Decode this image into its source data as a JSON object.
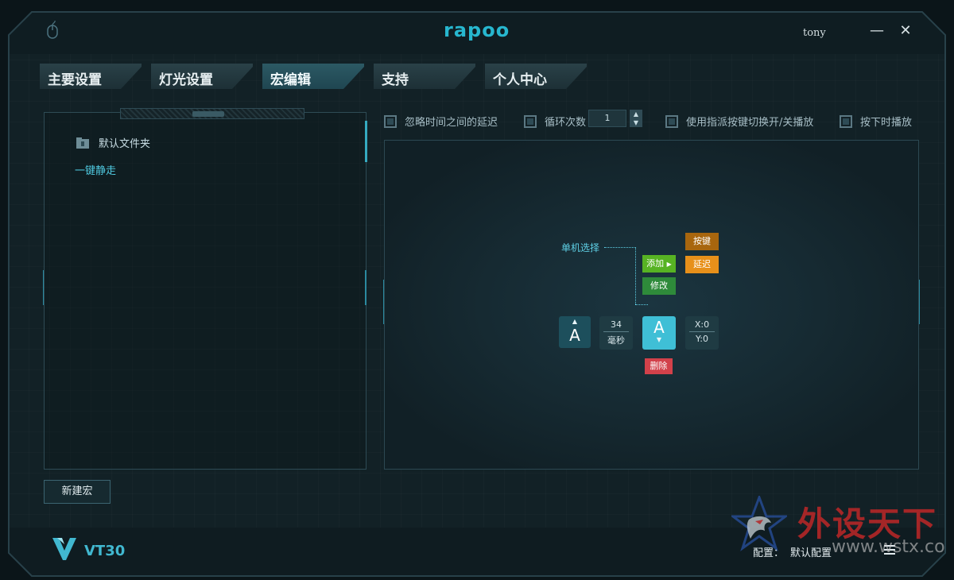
{
  "app": {
    "logo": "rapoo",
    "username": "tony",
    "minimize_symbol": "—",
    "close_symbol": "✕",
    "model": "VT30"
  },
  "tabs": [
    {
      "label": "主要设置",
      "active": false
    },
    {
      "label": "灯光设置",
      "active": false
    },
    {
      "label": "宏编辑",
      "active": true
    },
    {
      "label": "支持",
      "active": false
    },
    {
      "label": "个人中心",
      "active": false
    }
  ],
  "left_panel": {
    "folder_label": "默认文件夹",
    "macro_item": "一键静走",
    "new_macro_button": "新建宏"
  },
  "options": {
    "ignore_delay": "忽略时间之间的延迟",
    "loop_count_label": "循环次数",
    "loop_count_value": "1",
    "toggle_play": "使用指派按键切换开/关播放",
    "play_on_press": "按下时播放"
  },
  "editor": {
    "single_select": "单机选择",
    "add_button": "添加",
    "edit_button": "修改",
    "key_button": "按键",
    "delay_button": "延迟",
    "delete_button": "删除",
    "key_press_label": "A",
    "key_release_label": "A",
    "delay_value": "34",
    "delay_unit": "毫秒",
    "x_value": "X:0",
    "y_value": "Y:0"
  },
  "bottom": {
    "config_label": "配置：",
    "config_value": "默认配置"
  },
  "watermark": {
    "text": "外设天下",
    "url": "www.wstx.com"
  },
  "colors": {
    "accent": "#27b7cf",
    "add": "#57b323",
    "edit": "#2e8a3a",
    "key": "#a8660e",
    "delay": "#e7901a",
    "delete": "#d2414a"
  }
}
